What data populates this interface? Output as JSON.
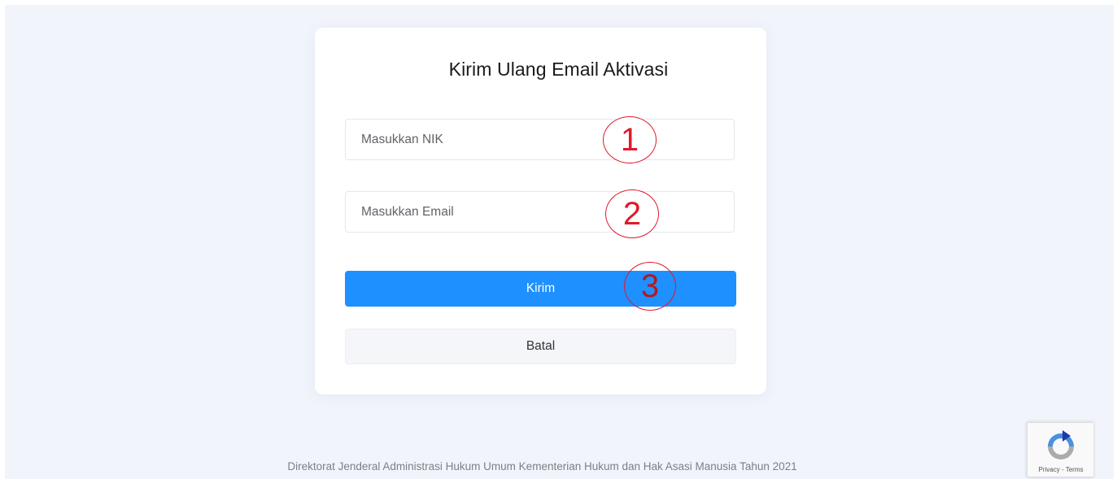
{
  "form": {
    "title": "Kirim Ulang Email Aktivasi",
    "nik_placeholder": "Masukkan NIK",
    "email_placeholder": "Masukkan Email",
    "submit_label": "Kirim",
    "cancel_label": "Batal"
  },
  "annotations": {
    "marker_1": "1",
    "marker_2": "2",
    "marker_3": "3",
    "color": "#e0192b"
  },
  "footer": {
    "text": "Direktorat Jenderal Administrasi Hukum Umum Kementerian Hukum dan Hak Asasi Manusia Tahun 2021"
  },
  "recaptcha": {
    "icon": "recaptcha-icon",
    "links": "Privacy - Terms"
  },
  "colors": {
    "primary": "#1e90ff",
    "page_background": "#f1f4fb",
    "card_background": "#ffffff"
  }
}
